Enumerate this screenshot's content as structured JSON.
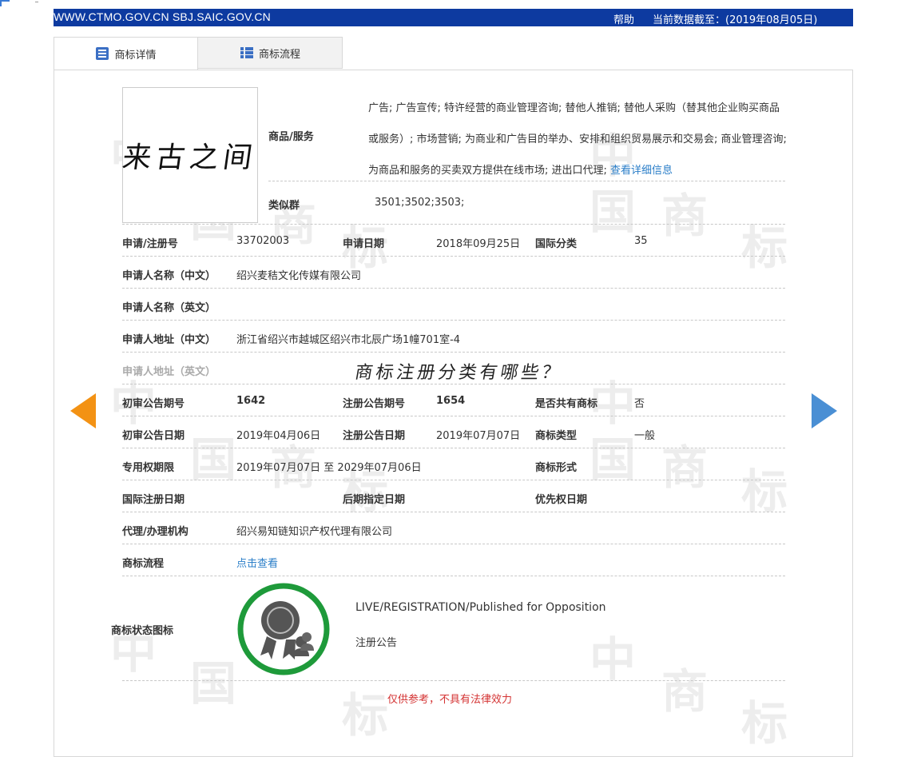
{
  "header": {
    "sites": "WWW.CTMO.GOV.CN SBJ.SAIC.GOV.CN",
    "help": "帮助",
    "data_as_of": "当前数据截至：(2019年08月05日)"
  },
  "tabs": [
    {
      "label": "商标详情",
      "icon": "document-list-icon",
      "active": true
    },
    {
      "label": "商标流程",
      "icon": "list-icon",
      "active": false
    }
  ],
  "trademark": {
    "logo_text": "来古之间",
    "goods_label": "商品/服务",
    "goods_text": "广告; 广告宣传; 特许经营的商业管理咨询; 替他人推销; 替他人采购（替其他企业购买商品或服务）; 市场营销; 为商业和广告目的举办、安排和组织贸易展示和交易会; 商业管理咨询; 为商品和服务的买卖双方提供在线市场; 进出口代理;",
    "goods_more_link": "查看详细信息",
    "similar_group_label": "类似群",
    "similar_group": "3501;3502;3503;",
    "reg_no_label": "申请/注册号",
    "reg_no": "33702003",
    "app_date_label": "申请日期",
    "app_date": "2018年09月25日",
    "intl_class_label": "国际分类",
    "intl_class": "35",
    "applicant_cn_label": "申请人名称（中文）",
    "applicant_cn": "绍兴麦秸文化传媒有限公司",
    "applicant_en_label": "申请人名称（英文）",
    "applicant_en": "",
    "address_cn_label": "申请人地址（中文）",
    "address_cn": "浙江省绍兴市越城区绍兴市北辰广场1幢701室-4",
    "address_en_label": "申请人地址（英文）",
    "address_en": "",
    "prelim_no_label": "初审公告期号",
    "prelim_no": "1642",
    "reg_pub_no_label": "注册公告期号",
    "reg_pub_no": "1654",
    "shared_label": "是否共有商标",
    "shared": "否",
    "prelim_date_label": "初审公告日期",
    "prelim_date": "2019年04月06日",
    "reg_pub_date_label": "注册公告日期",
    "reg_pub_date": "2019年07月07日",
    "tm_type_label": "商标类型",
    "tm_type": "一般",
    "exclusive_label": "专用权期限",
    "exclusive_period": "2019年07月07日 至 2029年07月06日",
    "tm_form_label": "商标形式",
    "tm_form": "",
    "intl_reg_date_label": "国际注册日期",
    "later_designation_label": "后期指定日期",
    "priority_date_label": "优先权日期",
    "agent_label": "代理/办理机构",
    "agent": "绍兴易知链知识产权代理有限公司",
    "process_label": "商标流程",
    "process_link": "点击查看",
    "status_icon_label": "商标状态图标",
    "status_en": "LIVE/REGISTRATION/Published for Opposition",
    "status_cn": "注册公告"
  },
  "overlay_question": "商标注册分类有哪些？",
  "disclaimer": "仅供参考，不具有法律效力",
  "watermark": [
    "中",
    "国",
    "商",
    "标"
  ],
  "colors": {
    "header_bg": "#0d3aa0",
    "link": "#2a7ec8",
    "arrow_left": "#f39214",
    "arrow_right": "#4a8fd4",
    "badge_ring": "#1e9a3a",
    "disclaimer": "#d43333"
  }
}
